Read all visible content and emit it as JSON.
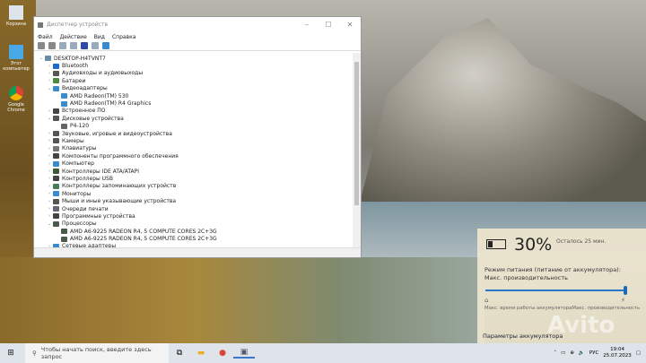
{
  "desktop": {
    "icons": [
      {
        "label": "Корзина",
        "icon": "recycle-bin-icon"
      },
      {
        "label": "Этот компьютер",
        "icon": "computer-icon"
      },
      {
        "label": "Google Chrome",
        "icon": "chrome-icon"
      }
    ]
  },
  "window": {
    "title": "Диспетчер устройств",
    "menu": [
      "Файл",
      "Действие",
      "Вид",
      "Справка"
    ],
    "tree": [
      {
        "label": "DESKTOP-H4TVNT7",
        "level": 0,
        "exp": "⌄"
      },
      {
        "label": "Bluetooth",
        "level": 1,
        "exp": "›"
      },
      {
        "label": "Аудиовходы и аудиовыходы",
        "level": 1,
        "exp": "›"
      },
      {
        "label": "Батареи",
        "level": 1,
        "exp": "›"
      },
      {
        "label": "Видеоадаптеры",
        "level": 1,
        "exp": "⌄"
      },
      {
        "label": "AMD Radeon(TM) 530",
        "level": 2,
        "exp": ""
      },
      {
        "label": "AMD Radeon(TM) R4 Graphics",
        "level": 2,
        "exp": ""
      },
      {
        "label": "Встроенное ПО",
        "level": 1,
        "exp": "›"
      },
      {
        "label": "Дисковые устройства",
        "level": 1,
        "exp": "⌄"
      },
      {
        "label": "P4-120",
        "level": 2,
        "exp": ""
      },
      {
        "label": "Звуковые, игровые и видеоустройства",
        "level": 1,
        "exp": "›"
      },
      {
        "label": "Камеры",
        "level": 1,
        "exp": "›"
      },
      {
        "label": "Клавиатуры",
        "level": 1,
        "exp": "›"
      },
      {
        "label": "Компоненты программного обеспечения",
        "level": 1,
        "exp": "›"
      },
      {
        "label": "Компьютер",
        "level": 1,
        "exp": "›"
      },
      {
        "label": "Контроллеры IDE ATA/ATAPI",
        "level": 1,
        "exp": "›"
      },
      {
        "label": "Контроллеры USB",
        "level": 1,
        "exp": "›"
      },
      {
        "label": "Контроллеры запоминающих устройств",
        "level": 1,
        "exp": "›"
      },
      {
        "label": "Мониторы",
        "level": 1,
        "exp": "›"
      },
      {
        "label": "Мыши и иные указывающие устройства",
        "level": 1,
        "exp": "›"
      },
      {
        "label": "Очереди печати",
        "level": 1,
        "exp": "›"
      },
      {
        "label": "Программные устройства",
        "level": 1,
        "exp": "›"
      },
      {
        "label": "Процессоры",
        "level": 1,
        "exp": "⌄"
      },
      {
        "label": "AMD A6-9225 RADEON R4, 5 COMPUTE CORES 2C+3G",
        "level": 2,
        "exp": ""
      },
      {
        "label": "AMD A6-9225 RADEON R4, 5 COMPUTE CORES 2C+3G",
        "level": 2,
        "exp": ""
      },
      {
        "label": "Сетевые адаптеры",
        "level": 1,
        "exp": "›"
      }
    ]
  },
  "battery": {
    "percent": "30%",
    "level": 0.3,
    "remaining": "Осталось 25 мин.",
    "mode": "Режим питания (питание от аккумулятора): Макс. производительность",
    "slider_value": 1.0,
    "left_label": "Макс. время работы аккумулятора",
    "right_label": "Макс. производительность",
    "settings_link": "Параметры аккумулятора"
  },
  "taskbar": {
    "search_placeholder": "Чтобы начать поиск, введите здесь запрос",
    "lang": "РУС",
    "time": "19:04",
    "date": "25.07.2023"
  },
  "watermark": "Avito"
}
